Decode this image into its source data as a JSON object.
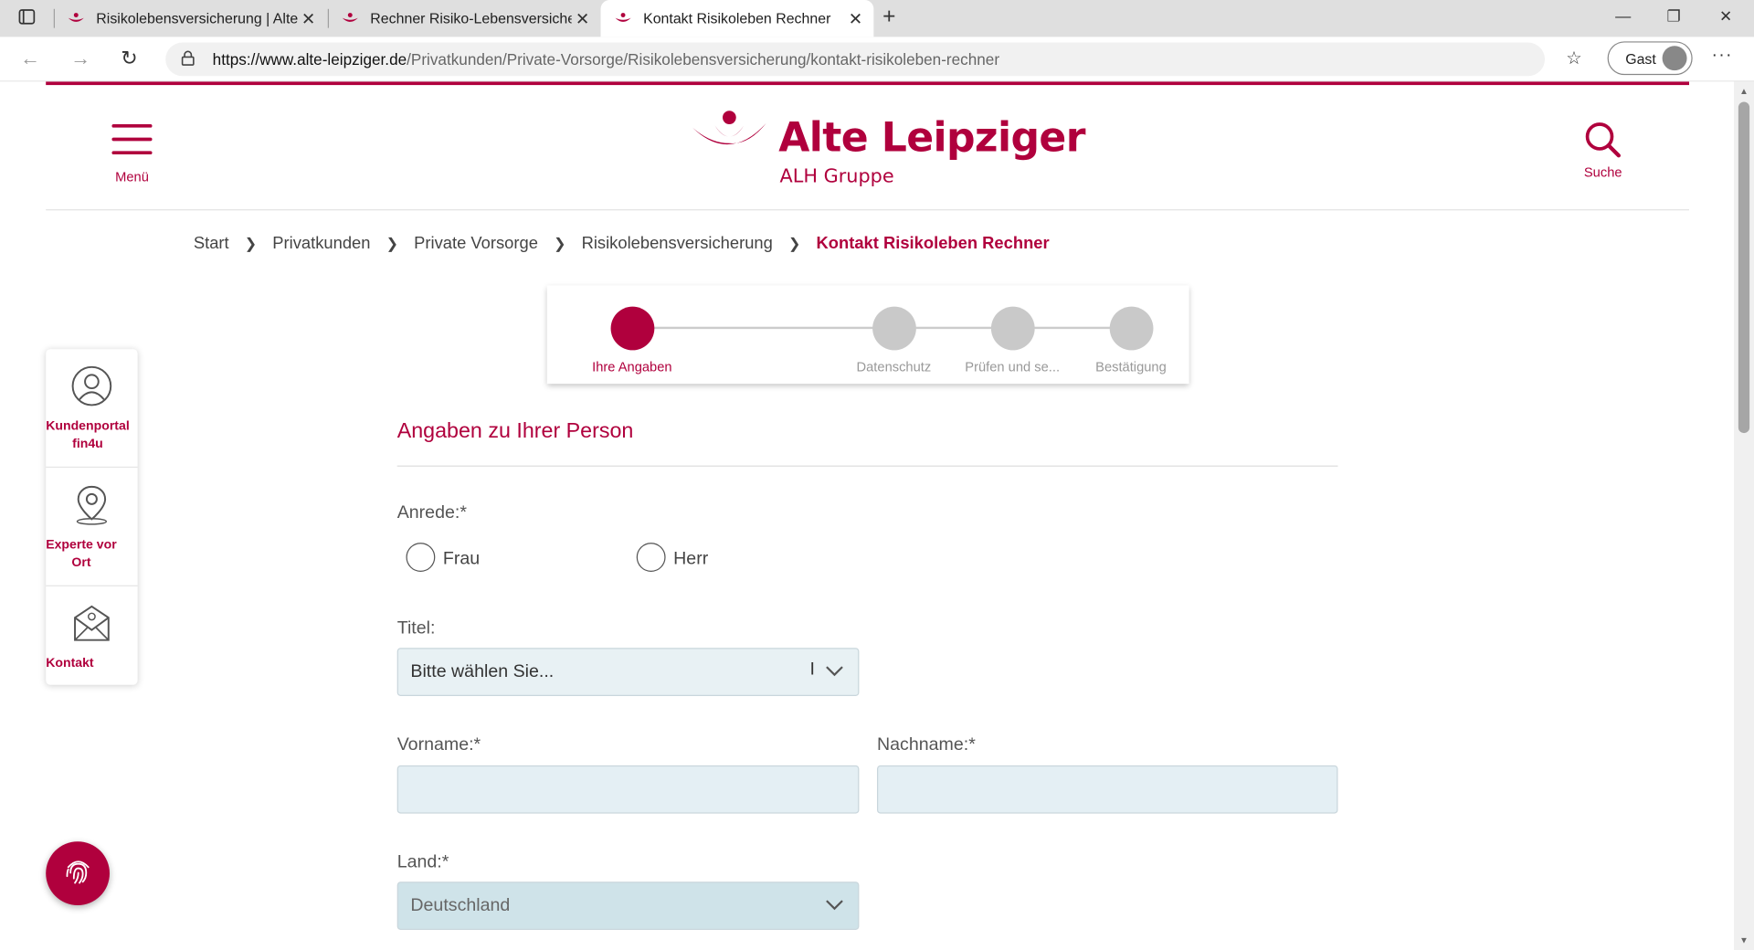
{
  "browser": {
    "tabs": [
      {
        "title": "Risikolebensversicherung | Alte L",
        "active": false
      },
      {
        "title": "Rechner Risiko-Lebensversicheru",
        "active": false
      },
      {
        "title": "Kontakt Risikoleben Rechner",
        "active": true
      }
    ],
    "url_host": "https://www.alte-leipziger.de",
    "url_path": "/Privatkunden/Private-Vorsorge/Risikolebensversicherung/kontakt-risikoleben-rechner",
    "profile_label": "Gast"
  },
  "header": {
    "menu_label": "Menü",
    "logo_name": "Alte Leipziger",
    "logo_sub": "ALH Gruppe",
    "search_label": "Suche",
    "brand_color": "#b0003d"
  },
  "breadcrumb": {
    "items": [
      "Start",
      "Privatkunden",
      "Private Vorsorge",
      "Risikolebensversicherung"
    ],
    "current": "Kontakt Risikoleben Rechner"
  },
  "stepper": {
    "steps": [
      "Ihre Angaben",
      "Datenschutz",
      "Prüfen und se...",
      "Bestätigung"
    ],
    "active_index": 0
  },
  "sidebar": {
    "items": [
      {
        "label_line1": "Kundenportal",
        "label_line2": "fin4u",
        "icon": "user-icon"
      },
      {
        "label_line1": "Experte vor",
        "label_line2": "Ort",
        "icon": "location-pin-icon"
      },
      {
        "label_line1": "Kontakt",
        "label_line2": "",
        "icon": "mail-icon"
      }
    ]
  },
  "form": {
    "section_title": "Angaben zu Ihrer Person",
    "anrede_label": "Anrede:*",
    "anrede_options": [
      "Frau",
      "Herr"
    ],
    "titel_label": "Titel:",
    "titel_value": "Bitte wählen Sie...",
    "vorname_label": "Vorname:*",
    "vorname_value": "",
    "nachname_label": "Nachname:*",
    "nachname_value": "",
    "land_label": "Land:*",
    "land_value": "Deutschland"
  }
}
